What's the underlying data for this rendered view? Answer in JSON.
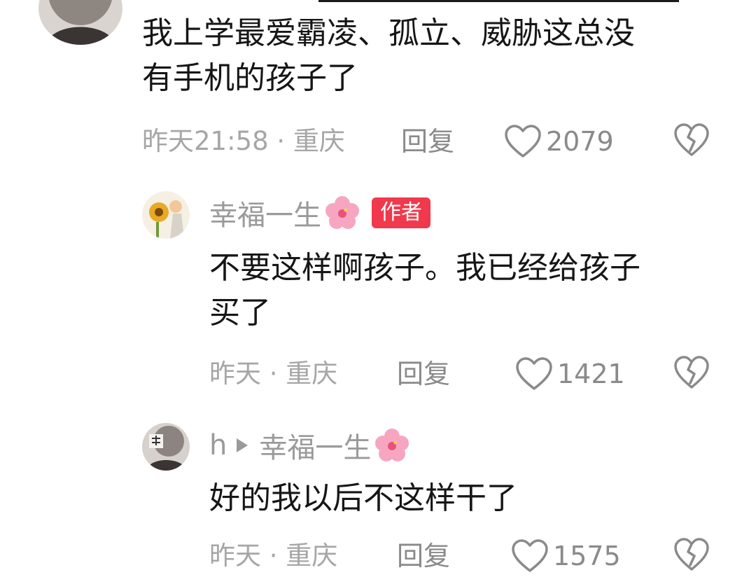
{
  "comments": [
    {
      "text_line1": "我上学最爱霸凌、孤立、威胁这总没",
      "text_line2": "有手机的孩子了",
      "meta": "昨天21:58 · 重庆",
      "reply_label": "回复",
      "likes": "2079"
    },
    {
      "username": "幸福一生",
      "badge": "作者",
      "text_line1": "不要这样啊孩子。我已经给孩子",
      "text_line2": "买了",
      "meta": "昨天 · 重庆",
      "reply_label": "回复",
      "likes": "1421"
    },
    {
      "username": "h",
      "reply_to": "幸福一生",
      "text_line1": "好的我以后不这样干了",
      "meta": "昨天 · 重庆",
      "reply_label": "回复",
      "likes": "1575"
    }
  ],
  "icons": {
    "like": "heart-outline-icon",
    "dislike": "broken-heart-icon",
    "name_decoration": "hibiscus-flower-icon",
    "reply_to_separator": "play-triangle-icon"
  },
  "colors": {
    "author_badge": "#f0394c",
    "meta_text": "#a6a6a6",
    "body_text": "#161616"
  }
}
